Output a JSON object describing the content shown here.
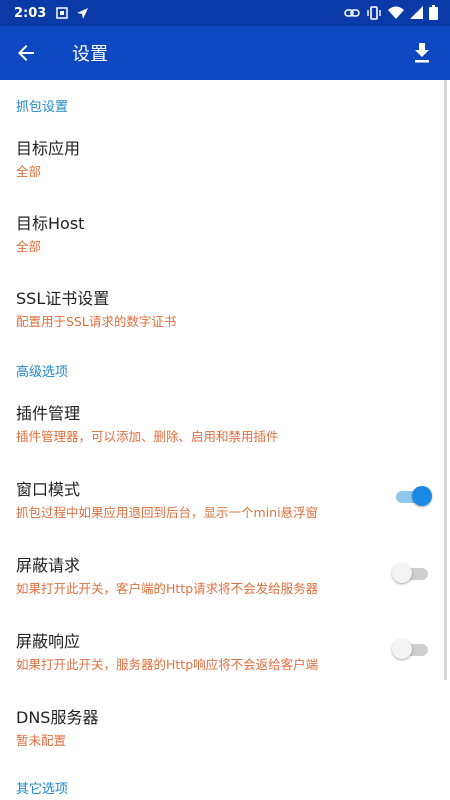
{
  "status_bar": {
    "time": "2:03",
    "icons_left": [
      "sim-card-icon",
      "location-arrow-icon"
    ],
    "icons_right": [
      "link-icon",
      "vibrate-icon",
      "wifi-icon",
      "signal-icon",
      "battery-icon"
    ]
  },
  "app_bar": {
    "title": "设置",
    "back_icon": "arrow-back-icon",
    "action_icon": "download-icon"
  },
  "sections": {
    "capture": {
      "header": "抓包设置",
      "items": [
        {
          "title": "目标应用",
          "summary": "全部"
        },
        {
          "title": "目标Host",
          "summary": "全部"
        },
        {
          "title": "SSL证书设置",
          "summary": "配置用于SSL请求的数字证书"
        }
      ]
    },
    "advanced": {
      "header": "高级选项",
      "items": [
        {
          "title": "插件管理",
          "summary": "插件管理器，可以添加、删除、启用和禁用插件"
        },
        {
          "title": "窗口模式",
          "summary": "抓包过程中如果应用退回到后台，显示一个mini悬浮窗",
          "switch": true
        },
        {
          "title": "屏蔽请求",
          "summary": "如果打开此开关，客户端的Http请求将不会发给服务器",
          "switch": false
        },
        {
          "title": "屏蔽响应",
          "summary": "如果打开此开关，服务器的Http响应将不会返给客户端",
          "switch": false
        },
        {
          "title": "DNS服务器",
          "summary": "暂未配置"
        }
      ]
    },
    "other": {
      "header": "其它选项"
    }
  },
  "colors": {
    "status_bar": "#0a3aa8",
    "app_bar": "#0d47c1",
    "section_header": "#1e88c8",
    "summary": "#e07040",
    "switch_on": "#1e88e5"
  }
}
